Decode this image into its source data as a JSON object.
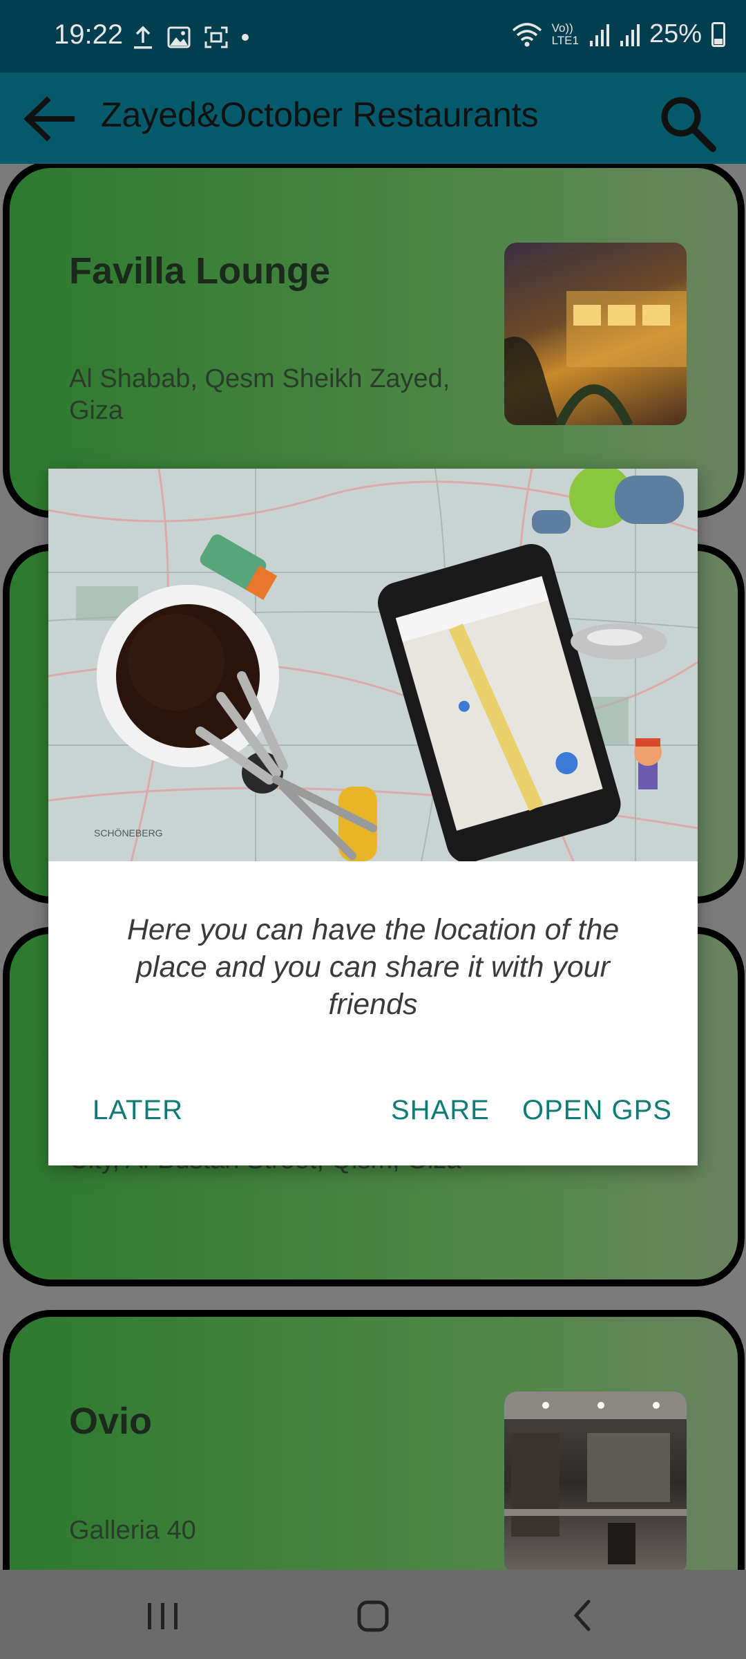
{
  "status": {
    "time": "19:22",
    "battery": "25%",
    "icons": [
      "upload-icon",
      "image-icon",
      "screenshot-icon",
      "dot-icon",
      "wifi-icon",
      "volte-icon",
      "signal-icon",
      "signal-icon",
      "battery-icon"
    ],
    "volte_label": "Vo))",
    "lte_label": "LTE1"
  },
  "app_bar": {
    "title": "Zayed&October Restaurants",
    "back_icon": "arrow-back-icon",
    "search_icon": "search-icon"
  },
  "restaurants": [
    {
      "name": "Favilla Lounge",
      "address": "Al Shabab, Qesm Sheikh Zayed, Giza"
    },
    {
      "name": "",
      "address": "City, Al-Bustan Street, Qism, Giza"
    },
    {
      "name": "Ovio",
      "address": "Galleria 40"
    }
  ],
  "dialog": {
    "message": "Here you can have the location of the place and you can share it with your friends",
    "buttons": {
      "later": "LATER",
      "share": "SHARE",
      "open_gps": "OPEN GPS"
    },
    "colors": {
      "accent": "#0e7c74"
    }
  },
  "nav": {
    "recents": "recents-icon",
    "home": "home-icon",
    "back": "back-icon"
  },
  "colors": {
    "status_bar": "#003e50",
    "app_bar": "#045a6a",
    "card": "#4c8644"
  }
}
